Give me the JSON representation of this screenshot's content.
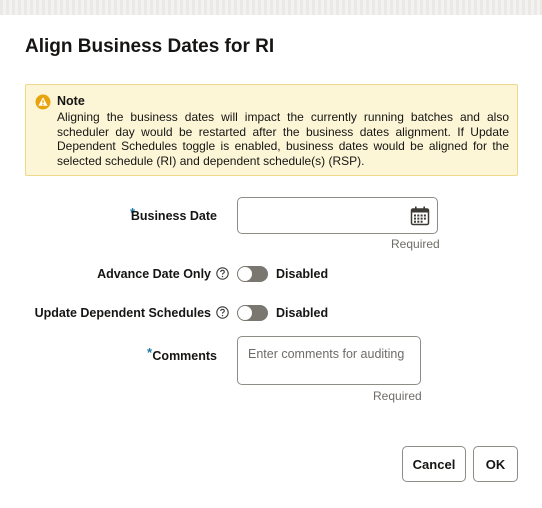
{
  "dialog": {
    "title": "Align Business Dates for RI"
  },
  "note": {
    "icon": "warning-icon",
    "title": "Note",
    "text": "Aligning the business dates will impact the currently running batches and also scheduler day would be restarted after the business dates alignment. If Update Dependent Schedules toggle is enabled, business dates would be aligned for the selected schedule (RI) and dependent schedule(s) (RSP)."
  },
  "form": {
    "business_date": {
      "required_marker": "*",
      "label": "Business Date",
      "value": "",
      "icon": "calendar-icon",
      "hint": "Required"
    },
    "advance_date_only": {
      "label": "Advance Date Only",
      "help_icon": "help-icon",
      "state": "Disabled"
    },
    "update_dependent_schedules": {
      "label": "Update Dependent Schedules",
      "help_icon": "help-icon",
      "state": "Disabled"
    },
    "comments": {
      "required_marker": "*",
      "label": "Comments",
      "placeholder": "Enter comments for auditing",
      "hint": "Required"
    }
  },
  "buttons": {
    "cancel": "Cancel",
    "ok": "OK"
  },
  "colors": {
    "note_background": "#fcf5d6",
    "warning": "#e8a40c",
    "required_marker": "#227aab",
    "toggle_off": "#7a7670"
  }
}
